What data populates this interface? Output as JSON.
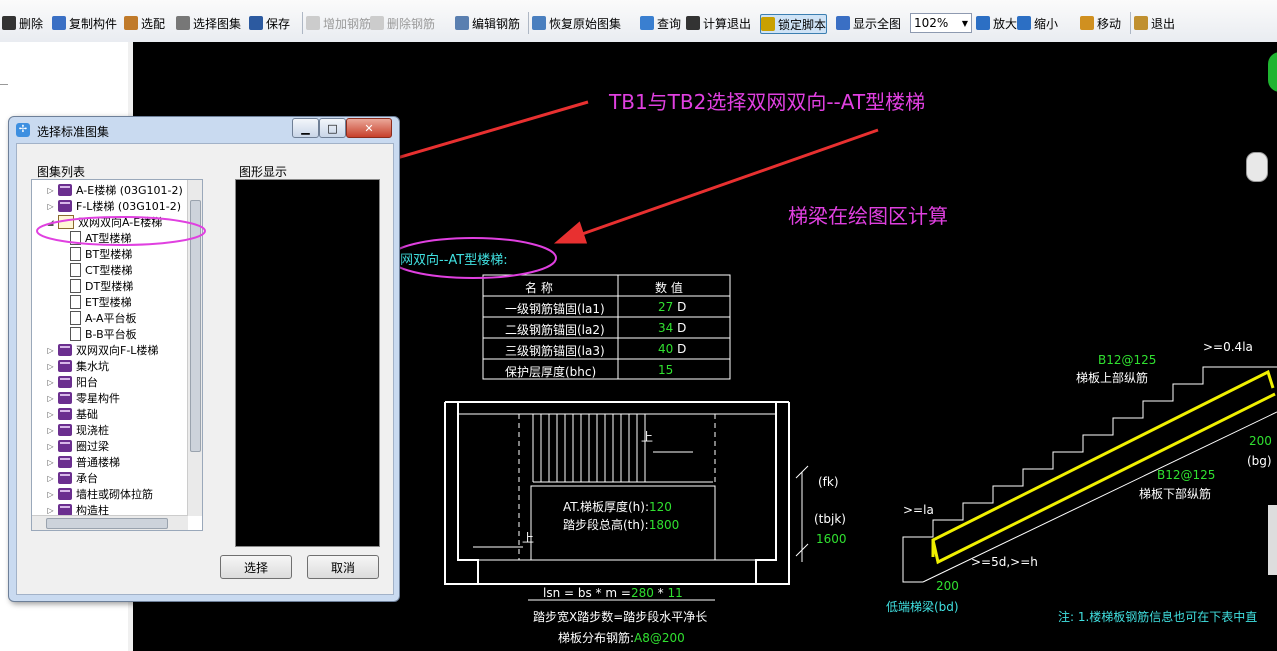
{
  "toolbar": {
    "items": [
      {
        "label": "删除",
        "icon": "delete-icon"
      },
      {
        "label": "复制构件",
        "icon": "copy-icon"
      },
      {
        "label": "选配",
        "icon": "match-icon"
      },
      {
        "label": "选择图集",
        "icon": "atlas-icon"
      },
      {
        "label": "保存",
        "icon": "save-icon"
      },
      {
        "label": "增加钢筋",
        "icon": "add-rebar-icon",
        "disabled": true
      },
      {
        "label": "删除钢筋",
        "icon": "delete-rebar-icon",
        "disabled": true
      },
      {
        "label": "编辑钢筋",
        "icon": "edit-rebar-icon"
      },
      {
        "label": "恢复原始图集",
        "icon": "restore-icon"
      },
      {
        "label": "查询",
        "icon": "query-icon"
      },
      {
        "label": "计算退出",
        "icon": "calc-exit-icon"
      },
      {
        "label": "锁定脚本",
        "icon": "lock-icon",
        "pressed": true
      },
      {
        "label": "显示全图",
        "icon": "fit-icon"
      },
      {
        "label": "放大",
        "icon": "zoom-in-icon"
      },
      {
        "label": "缩小",
        "icon": "zoom-out-icon"
      },
      {
        "label": "移动",
        "icon": "pan-icon"
      },
      {
        "label": "退出",
        "icon": "exit-icon"
      }
    ],
    "zoom": "102%"
  },
  "dialog": {
    "title": "选择标准图集",
    "list_label": "图集列表",
    "preview_label": "图形显示",
    "tree": [
      {
        "label": "A-E楼梯 (03G101-2)",
        "level": 0,
        "type": "book",
        "expand": "▷"
      },
      {
        "label": "F-L楼梯 (03G101-2)",
        "level": 0,
        "type": "book",
        "expand": "▷"
      },
      {
        "label": "双网双向A-E楼梯",
        "level": 0,
        "type": "open",
        "expand": "◢"
      },
      {
        "label": "AT型楼梯",
        "level": 1,
        "type": "doc",
        "expand": ""
      },
      {
        "label": "BT型楼梯",
        "level": 1,
        "type": "doc",
        "expand": ""
      },
      {
        "label": "CT型楼梯",
        "level": 1,
        "type": "doc",
        "expand": ""
      },
      {
        "label": "DT型楼梯",
        "level": 1,
        "type": "doc",
        "expand": ""
      },
      {
        "label": "ET型楼梯",
        "level": 1,
        "type": "doc",
        "expand": ""
      },
      {
        "label": "A-A平台板",
        "level": 1,
        "type": "doc",
        "expand": ""
      },
      {
        "label": "B-B平台板",
        "level": 1,
        "type": "doc",
        "expand": ""
      },
      {
        "label": "双网双向F-L楼梯",
        "level": 0,
        "type": "book",
        "expand": "▷"
      },
      {
        "label": "集水坑",
        "level": 0,
        "type": "book",
        "expand": "▷"
      },
      {
        "label": "阳台",
        "level": 0,
        "type": "book",
        "expand": "▷"
      },
      {
        "label": "零星构件",
        "level": 0,
        "type": "book",
        "expand": "▷"
      },
      {
        "label": "基础",
        "level": 0,
        "type": "book",
        "expand": "▷"
      },
      {
        "label": "现浇桩",
        "level": 0,
        "type": "book",
        "expand": "▷"
      },
      {
        "label": "圈过梁",
        "level": 0,
        "type": "book",
        "expand": "▷"
      },
      {
        "label": "普通楼梯",
        "level": 0,
        "type": "book",
        "expand": "▷"
      },
      {
        "label": "承台",
        "level": 0,
        "type": "book",
        "expand": "▷"
      },
      {
        "label": "墙柱或砌体拉筋",
        "level": 0,
        "type": "book",
        "expand": "▷"
      },
      {
        "label": "构造柱",
        "level": 0,
        "type": "book",
        "expand": "▷"
      }
    ],
    "select_button": "选择",
    "cancel_button": "取消"
  },
  "canvas": {
    "annotation1": "TB1与TB2选择双网双向--AT型楼梯",
    "annotation2": "梯梁在绘图区计算",
    "heading": "双网双向--AT型楼梯:",
    "table_headers": [
      "名  称",
      "数  值"
    ],
    "table_rows": [
      {
        "name": "一级钢筋锚固(la1)",
        "value": "27",
        "unit": "D"
      },
      {
        "name": "二级钢筋锚固(la2)",
        "value": "34",
        "unit": "D"
      },
      {
        "name": "三级钢筋锚固(la3)",
        "value": "40",
        "unit": "D"
      },
      {
        "name": "保护层厚度(bhc)",
        "value": "15",
        "unit": ""
      }
    ],
    "plan": {
      "up_label_1": "上",
      "up_label_2": "上",
      "thickness_label": "AT.梯板厚度(h):",
      "thickness_value": "120",
      "height_label": "踏步段总高(th):",
      "height_value": "1800",
      "fk_label": "(fk)",
      "tbjk_label": "(tbjk)",
      "tbjk_value": "1600",
      "formula_prefix": "lsn = bs * m =",
      "formula_bs": "280",
      "formula_op": " * ",
      "formula_m": "11",
      "formula_caption": "踏步宽X踏步数=踏步段水平净长",
      "distribution_label": "梯板分布钢筋:",
      "distribution_value": "A8@200"
    },
    "section": {
      "dim_top": ">=0.4la",
      "top_rebar": "B12@125",
      "top_rebar_desc": "梯板上部纵筋",
      "bottom_rebar": "B12@125",
      "bottom_rebar_desc": "梯板下部纵筋",
      "dim_200_right": "200",
      "bg_label": "(bg)",
      "la_label": ">=la",
      "hook_label": ">=5d,>=h",
      "dim_200_left": "200",
      "low_beam": "低端梯梁(bd)",
      "note": "注: 1.楼梯板钢筋信息也可在下表中直"
    }
  },
  "colors": {
    "annotation": "#e040e0",
    "cyan": "#40e0e0",
    "green": "#30e030",
    "rebar": "#f0f000",
    "arrow": "#e83030"
  }
}
